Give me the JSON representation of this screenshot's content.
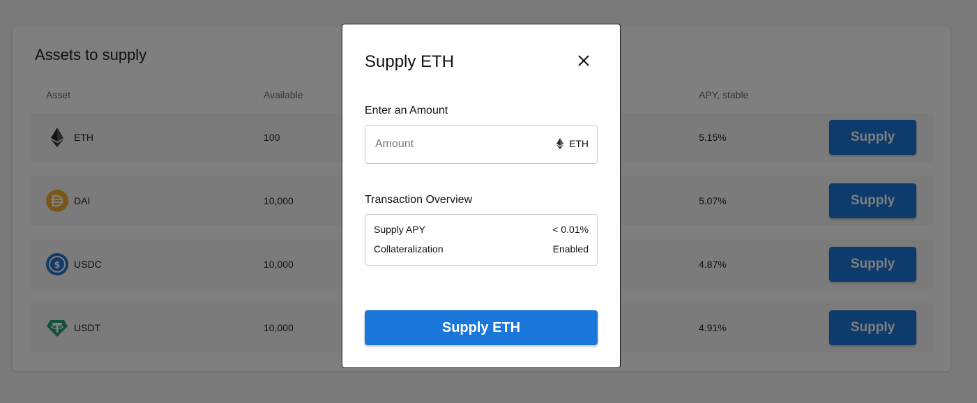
{
  "panel": {
    "title": "Assets to supply",
    "columns": {
      "asset": "Asset",
      "available": "Available",
      "apy": "APY, stable"
    },
    "rows": [
      {
        "asset": "ETH",
        "available": "100",
        "apy": "5.15%",
        "button": "Supply",
        "icon": "eth-icon",
        "color": "#2b2b2b"
      },
      {
        "asset": "DAI",
        "available": "10,000",
        "apy": "5.07%",
        "button": "Supply",
        "icon": "dai-icon",
        "color": "#f5ac37"
      },
      {
        "asset": "USDC",
        "available": "10,000",
        "apy": "4.87%",
        "button": "Supply",
        "icon": "usdc-icon",
        "color": "#2775ca"
      },
      {
        "asset": "USDT",
        "available": "10,000",
        "apy": "4.91%",
        "button": "Supply",
        "icon": "usdt-icon",
        "color": "#26a17b"
      }
    ]
  },
  "modal": {
    "title": "Supply ETH",
    "amount_label": "Enter an Amount",
    "amount_placeholder": "Amount",
    "amount_value": "",
    "token": "ETH",
    "overview_label": "Transaction Overview",
    "overview": [
      {
        "label": "Supply APY",
        "value": "< 0.01%"
      },
      {
        "label": "Collateralization",
        "value": "Enabled"
      }
    ],
    "submit_label": "Supply ETH"
  },
  "colors": {
    "accent": "#1a76d9",
    "overlay": "rgba(0,0,0,0.5)"
  }
}
